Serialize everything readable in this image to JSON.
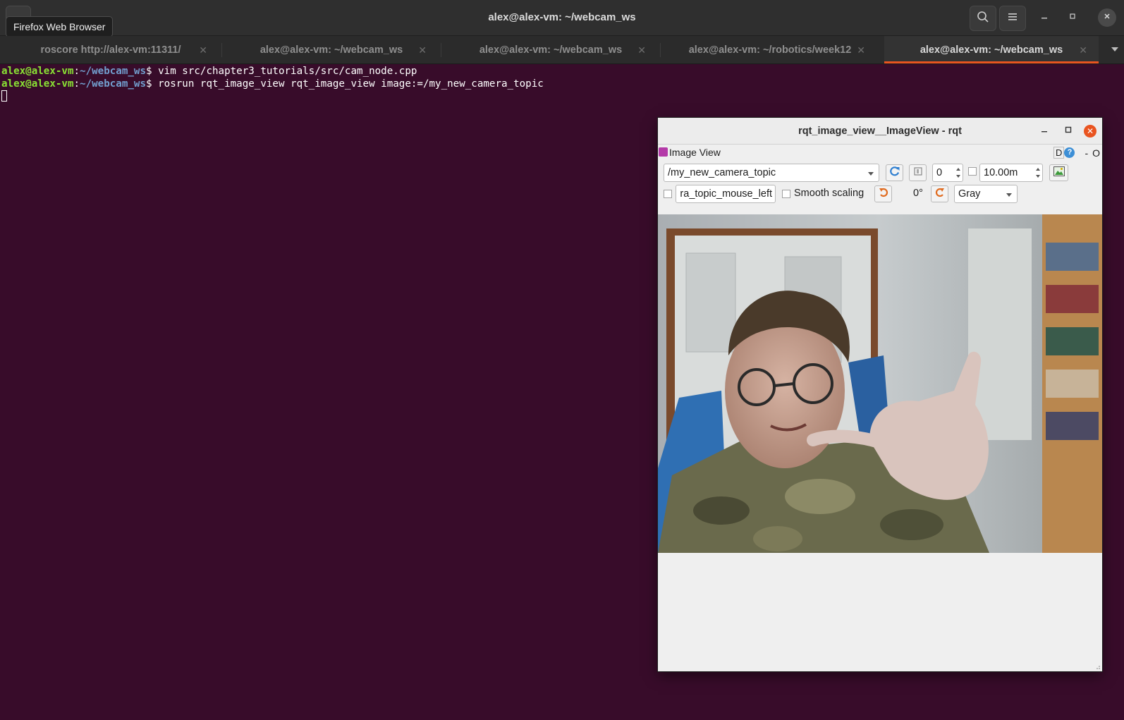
{
  "window": {
    "title": "alex@alex-vm: ~/webcam_ws",
    "tooltip": "Firefox Web Browser"
  },
  "icons": [
    "search-icon",
    "hamburger-menu-icon",
    "minimize-icon",
    "maximize-icon",
    "close-icon",
    "chevron-down-icon"
  ],
  "tabs": [
    {
      "label": "roscore http://alex-vm:11311/",
      "active": false
    },
    {
      "label": "alex@alex-vm: ~/webcam_ws",
      "active": false
    },
    {
      "label": "alex@alex-vm: ~/webcam_ws",
      "active": false
    },
    {
      "label": "alex@alex-vm: ~/robotics/week12",
      "active": false
    },
    {
      "label": "alex@alex-vm: ~/webcam_ws",
      "active": true
    }
  ],
  "terminal": {
    "prompt_user": "alex@alex-vm",
    "prompt_sep": ":",
    "prompt_path": "~/webcam_ws",
    "prompt_symbol": "$",
    "commands": [
      "vim src/chapter3_tutorials/src/cam_node.cpp",
      "rosrun rqt_image_view rqt_image_view image:=/my_new_camera_topic"
    ]
  },
  "rqt": {
    "title": "rqt_image_view__ImageView - rqt",
    "plugin_title": "Image View",
    "plugin_right_d": "D",
    "plugin_right_help": "?",
    "plugin_right_dash": "-",
    "plugin_right_o": "O",
    "topic": "/my_new_camera_topic",
    "spin_value": "0",
    "timeout_value": "10.00m",
    "mouse_topic": "ra_topic_mouse_left",
    "smooth_scaling_label": "Smooth scaling",
    "rotation": "0°",
    "color_scheme": "Gray"
  },
  "colors": {
    "terminal_bg": "#380c2a",
    "prompt_user": "#8ae234",
    "prompt_path": "#729fcf",
    "accent": "#e95420"
  }
}
